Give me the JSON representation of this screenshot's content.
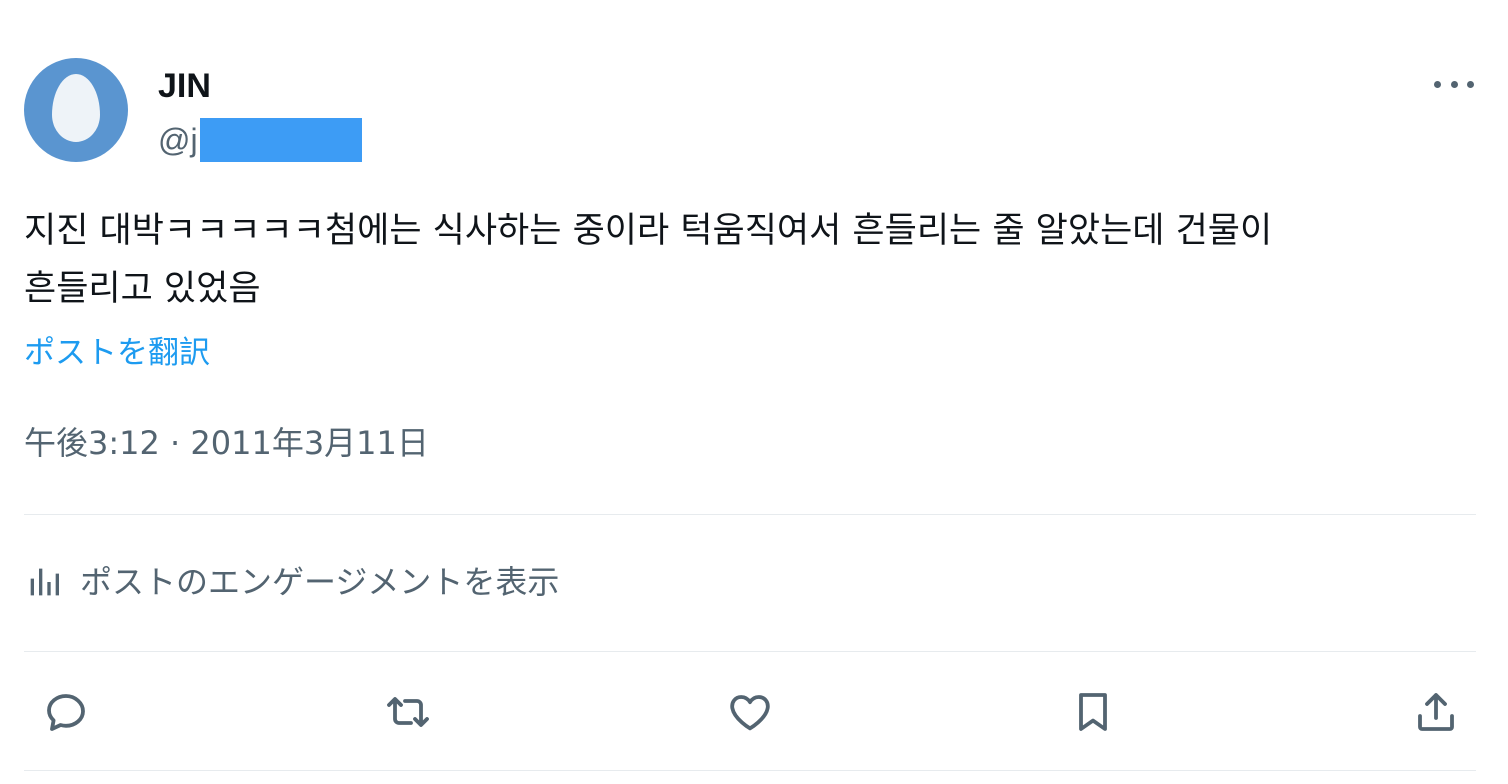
{
  "author": {
    "display_name": "JIN",
    "handle": "@j"
  },
  "tweet": {
    "text": "지진 대박ㅋㅋㅋㅋㅋ첨에는 식사하는 중이라 턱움직여서 흔들리는 줄 알았는데 건물이\n흔들리고 있었음",
    "translate_label": "ポストを翻訳",
    "timestamp": "午後3:12 · 2011年3月11日"
  },
  "engagement": {
    "label": "ポストのエンゲージメントを表示",
    "icon": "analytics-icon"
  },
  "actions": [
    {
      "name": "reply",
      "icon": "reply-icon"
    },
    {
      "name": "retweet",
      "icon": "retweet-icon"
    },
    {
      "name": "like",
      "icon": "heart-icon"
    },
    {
      "name": "bookmark",
      "icon": "bookmark-icon"
    },
    {
      "name": "share",
      "icon": "share-icon"
    }
  ],
  "colors": {
    "accent": "#1d9bf0",
    "text_primary": "#0f1419",
    "text_secondary": "#536471",
    "avatar_bg": "#5a95d0",
    "redaction": "#3d9cf5",
    "divider": "#e7ebee"
  }
}
